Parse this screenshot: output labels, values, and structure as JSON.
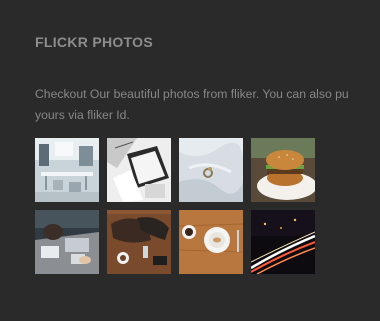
{
  "widget": {
    "title": "FLICKR PHOTOS",
    "description": "Checkout Our beautiful photos from fliker. You can also pu yours via fliker Id.",
    "colors": {
      "background": "#2a2a2a",
      "title": "#8d8d8d",
      "text": "#878787"
    }
  },
  "photos": [
    {
      "icon": "office-workspace-photo"
    },
    {
      "icon": "notebook-laptop-photo"
    },
    {
      "icon": "ring-on-fabric-photo"
    },
    {
      "icon": "burger-on-plate-photo"
    },
    {
      "icon": "people-at-desk-photo"
    },
    {
      "icon": "coffee-table-items-photo"
    },
    {
      "icon": "breakfast-on-wood-photo"
    },
    {
      "icon": "night-light-trails-photo"
    }
  ]
}
